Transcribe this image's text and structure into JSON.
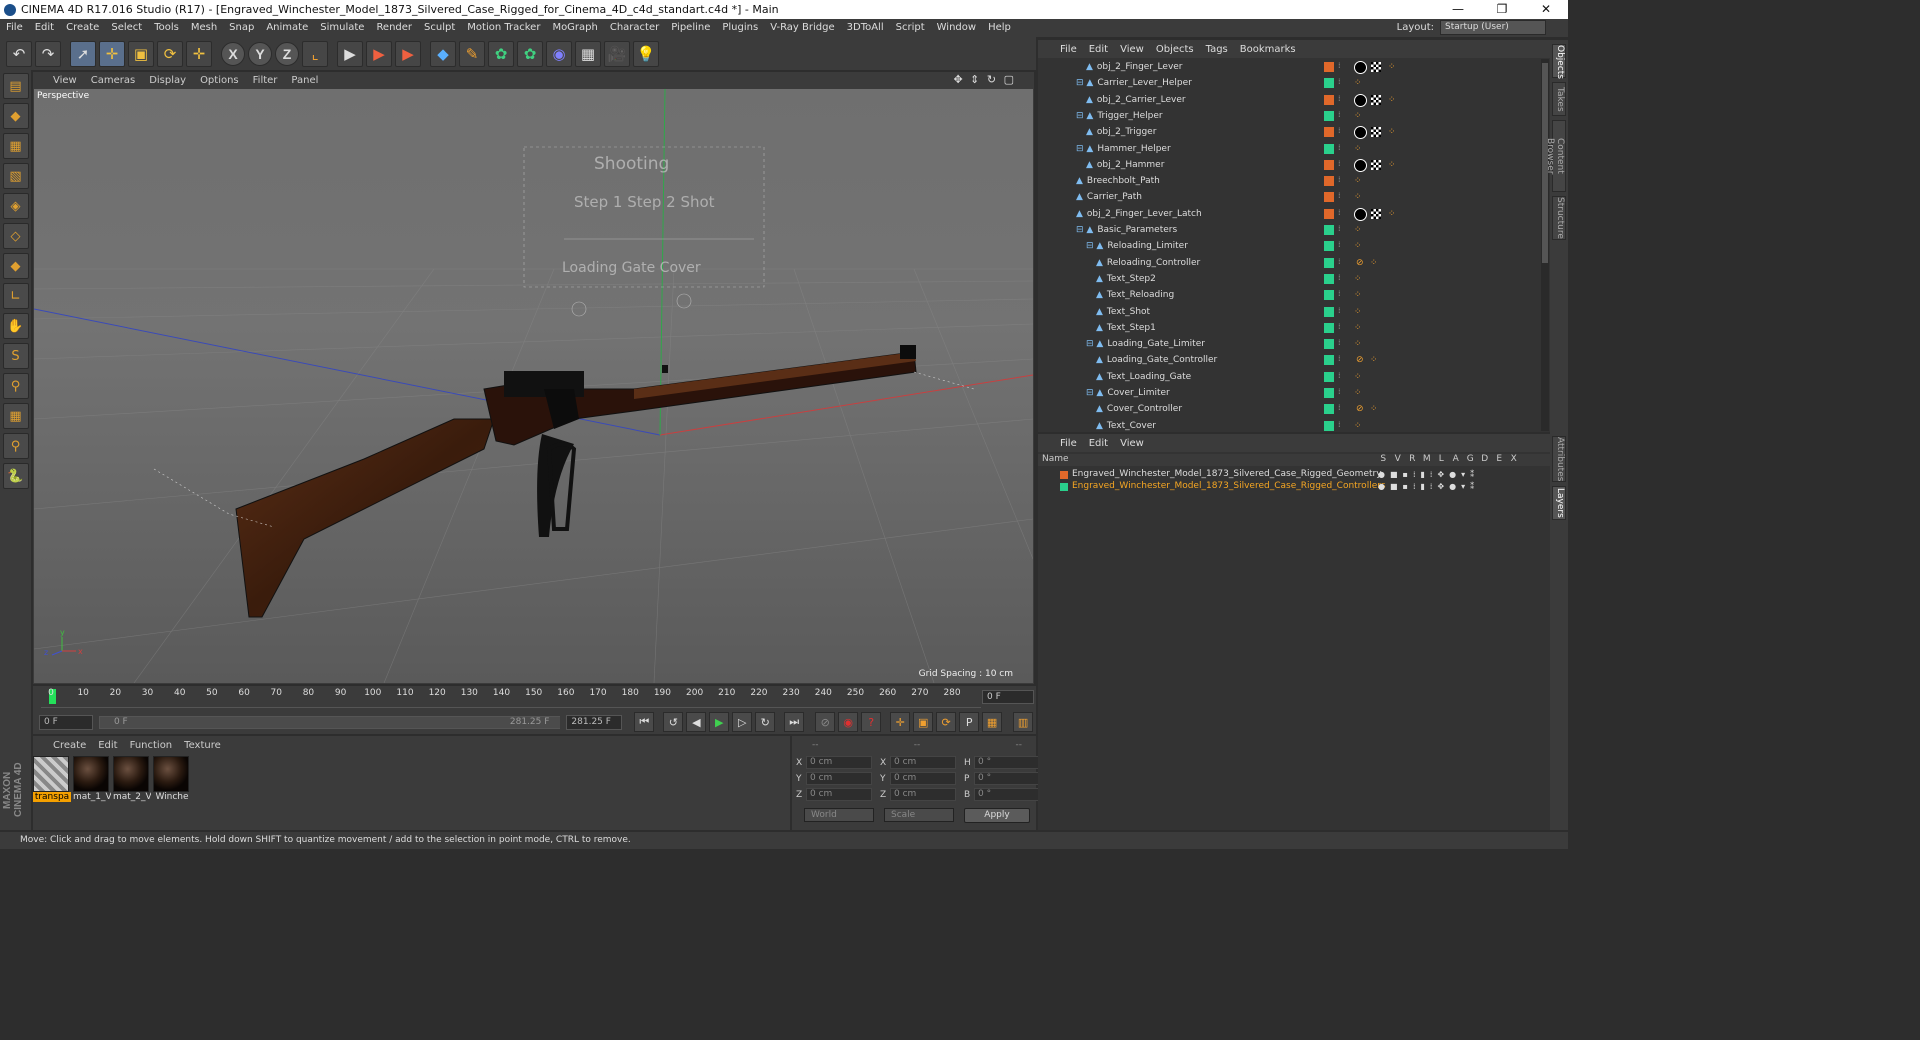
{
  "titlebar": {
    "title": "CINEMA 4D R17.016 Studio (R17) - [Engraved_Winchester_Model_1873_Silvered_Case_Rigged_for_Cinema_4D_c4d_standart.c4d *] - Main",
    "minimize": "—",
    "maximize": "❐",
    "close": "✕"
  },
  "menu": [
    "File",
    "Edit",
    "Create",
    "Select",
    "Tools",
    "Mesh",
    "Snap",
    "Animate",
    "Simulate",
    "Render",
    "Sculpt",
    "Motion Tracker",
    "MoGraph",
    "Character",
    "Pipeline",
    "Plugins",
    "V-Ray Bridge",
    "3DToAll",
    "Script",
    "Window",
    "Help"
  ],
  "layout": {
    "label": "Layout:",
    "value": "Startup (User)"
  },
  "toolbar": {
    "undo": "↶",
    "redo": "↷",
    "select": "➚",
    "move": "✛",
    "scale": "▣",
    "rotate": "⟳",
    "transform": "✛",
    "x": "X",
    "y": "Y",
    "z": "Z",
    "coord": "⌞",
    "render1": "▶",
    "render2": "▶",
    "render3": "▶",
    "cube": "◆",
    "pen": "✎",
    "gen1": "✿",
    "gen2": "✿",
    "deform": "◉",
    "floor": "▦",
    "camera": "🎥",
    "light": "💡"
  },
  "lefttools": [
    "▤",
    "◆",
    "▦",
    "▧",
    "◈",
    "◇",
    "◆",
    "∟",
    "✋",
    "S",
    "⚲",
    "▦",
    "⚲",
    "🐍"
  ],
  "viewport": {
    "menu": [
      "View",
      "Cameras",
      "Display",
      "Options",
      "Filter",
      "Panel"
    ],
    "nav_icons": "✥ ⇕ ↻ ▢",
    "label": "Perspective",
    "grid_spacing": "Grid Spacing : 10 cm",
    "hud_texts": [
      "Shooting",
      "Step 1  Step 2  Shot",
      "Loading Gate  Cover"
    ]
  },
  "timeline": {
    "ticks": [
      "0",
      "10",
      "20",
      "30",
      "40",
      "50",
      "60",
      "70",
      "80",
      "90",
      "100",
      "110",
      "120",
      "130",
      "140",
      "150",
      "160",
      "170",
      "180",
      "190",
      "200",
      "210",
      "220",
      "230",
      "240",
      "250",
      "260",
      "270",
      "280"
    ],
    "current_frame": "0 F"
  },
  "transport": {
    "start": "0 F",
    "range_start": "0 F",
    "range_end": "281.25 F",
    "end": "281.25 F"
  },
  "materials": {
    "menu": [
      "Create",
      "Edit",
      "Function",
      "Texture"
    ],
    "items": [
      {
        "name": "transpa",
        "transparent": true,
        "selected": true
      },
      {
        "name": "mat_1_V",
        "transparent": false,
        "selected": false
      },
      {
        "name": "mat_2_V",
        "transparent": false,
        "selected": false
      },
      {
        "name": "Winche",
        "transparent": false,
        "selected": false
      }
    ]
  },
  "attributes": {
    "header": [
      "--",
      "--",
      "--"
    ],
    "rows": [
      {
        "a": "X",
        "av": "0 cm",
        "b": "X",
        "bv": "0 cm",
        "c": "H",
        "cv": "0 °"
      },
      {
        "a": "Y",
        "av": "0 cm",
        "b": "Y",
        "bv": "0 cm",
        "c": "P",
        "cv": "0 °"
      },
      {
        "a": "Z",
        "av": "0 cm",
        "b": "Z",
        "bv": "0 cm",
        "c": "B",
        "cv": "0 °"
      }
    ],
    "coord_mode": "World",
    "size_mode": "Scale",
    "apply": "Apply"
  },
  "status": "Move: Click and drag to move elements. Hold down SHIFT to quantize movement / add to the selection in point mode, CTRL to remove.",
  "object_manager": {
    "menu": [
      "File",
      "Edit",
      "View",
      "Objects",
      "Tags",
      "Bookmarks"
    ],
    "rows": [
      {
        "name": "obj_2_Finger_Lever",
        "indent": 3,
        "tag": "#e0682a",
        "mesh": true
      },
      {
        "name": "Carrier_Lever_Helper",
        "indent": 2,
        "tag": "#2ad08c",
        "mesh": false,
        "folder": true
      },
      {
        "name": "obj_2_Carrier_Lever",
        "indent": 3,
        "tag": "#e0682a",
        "mesh": true
      },
      {
        "name": "Trigger_Helper",
        "indent": 2,
        "tag": "#2ad08c",
        "mesh": false,
        "folder": true
      },
      {
        "name": "obj_2_Trigger",
        "indent": 3,
        "tag": "#e0682a",
        "mesh": true
      },
      {
        "name": "Hammer_Helper",
        "indent": 2,
        "tag": "#2ad08c",
        "mesh": false,
        "folder": true
      },
      {
        "name": "obj_2_Hammer",
        "indent": 3,
        "tag": "#e0682a",
        "mesh": true
      },
      {
        "name": "Breechbolt_Path",
        "indent": 2,
        "tag": "#e0682a",
        "mesh": false
      },
      {
        "name": "Carrier_Path",
        "indent": 2,
        "tag": "#e0682a",
        "mesh": false
      },
      {
        "name": "obj_2_Finger_Lever_Latch",
        "indent": 2,
        "tag": "#e0682a",
        "mesh": true
      },
      {
        "name": "Basic_Parameters",
        "indent": 2,
        "tag": "#2ad08c",
        "mesh": false,
        "folder": true
      },
      {
        "name": "Reloading_Limiter",
        "indent": 3,
        "tag": "#2ad08c",
        "mesh": false,
        "folder": true
      },
      {
        "name": "Reloading_Controller",
        "indent": 4,
        "tag": "#2ad08c",
        "mesh": false,
        "ctrl": true
      },
      {
        "name": "Text_Step2",
        "indent": 4,
        "tag": "#2ad08c",
        "mesh": false
      },
      {
        "name": "Text_Reloading",
        "indent": 4,
        "tag": "#2ad08c",
        "mesh": false
      },
      {
        "name": "Text_Shot",
        "indent": 4,
        "tag": "#2ad08c",
        "mesh": false
      },
      {
        "name": "Text_Step1",
        "indent": 4,
        "tag": "#2ad08c",
        "mesh": false
      },
      {
        "name": "Loading_Gate_Limiter",
        "indent": 3,
        "tag": "#2ad08c",
        "mesh": false,
        "folder": true
      },
      {
        "name": "Loading_Gate_Controller",
        "indent": 4,
        "tag": "#2ad08c",
        "mesh": false,
        "ctrl": true
      },
      {
        "name": "Text_Loading_Gate",
        "indent": 4,
        "tag": "#2ad08c",
        "mesh": false
      },
      {
        "name": "Cover_Limiter",
        "indent": 3,
        "tag": "#2ad08c",
        "mesh": false,
        "folder": true
      },
      {
        "name": "Cover_Controller",
        "indent": 4,
        "tag": "#2ad08c",
        "mesh": false,
        "ctrl": true
      },
      {
        "name": "Text_Cover",
        "indent": 4,
        "tag": "#2ad08c",
        "mesh": false
      }
    ]
  },
  "layer_manager": {
    "menu": [
      "File",
      "Edit",
      "View"
    ],
    "name_header": "Name",
    "columns": [
      "S",
      "V",
      "R",
      "M",
      "L",
      "A",
      "G",
      "D",
      "E",
      "X"
    ],
    "layers": [
      {
        "name": "Engraved_Winchester_Model_1873_Silvered_Case_Rigged_Geometry",
        "color": "#e0682a",
        "text_color": "#dddddd"
      },
      {
        "name": "Engraved_Winchester_Model_1873_Silvered_Case_Rigged_Controllers",
        "color": "#2ad08c",
        "text_color": "#f5a623"
      }
    ]
  },
  "side_tabs": [
    "Objects",
    "Takes",
    "Content Browser",
    "Structure"
  ],
  "side_tabs_lower": [
    "Attributes",
    "Layers"
  ]
}
